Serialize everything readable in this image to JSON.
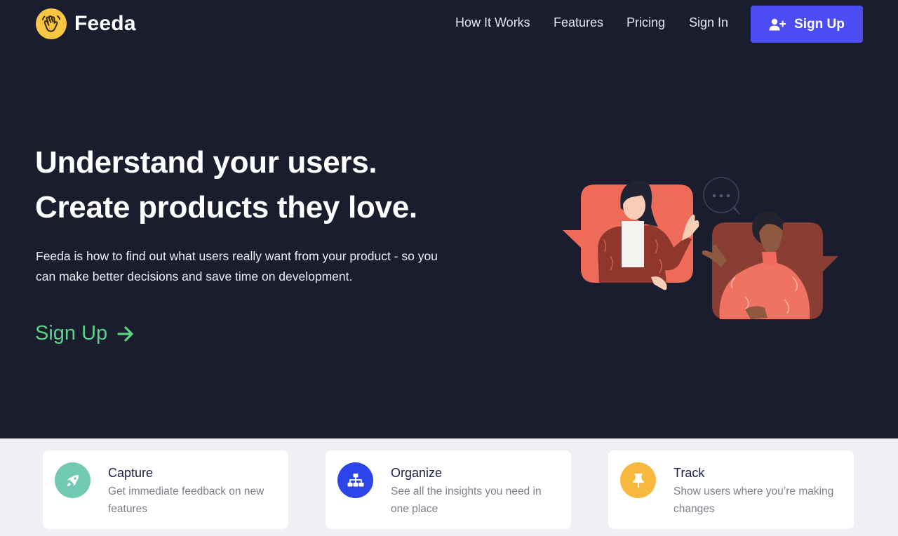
{
  "brand": {
    "name": "Feeda",
    "logo_icon": "waving-hand-icon"
  },
  "nav": {
    "links": [
      "How It Works",
      "Features",
      "Pricing",
      "Sign In"
    ],
    "signup_label": "Sign Up",
    "signup_icon": "user-plus-icon"
  },
  "hero": {
    "headline_line1": "Understand your users.",
    "headline_line2": "Create products they love.",
    "subtext": "Feeda is how to find out what users really want from your product - so you can make better decisions and save time on development.",
    "cta_label": "Sign Up",
    "cta_icon": "arrow-right-icon",
    "illustration": "two-people-chatting-illustration"
  },
  "features": [
    {
      "title": "Capture",
      "description": "Get immediate feedback on new features",
      "icon": "rocket-icon",
      "color": "#6fcab1"
    },
    {
      "title": "Organize",
      "description": "See all the insights you need in one place",
      "icon": "sitemap-icon",
      "color": "#2b45e8"
    },
    {
      "title": "Track",
      "description": "Show users where you’re making changes",
      "icon": "pushpin-icon",
      "color": "#f6b83f"
    }
  ],
  "colors": {
    "hero_bg": "#1a1d2e",
    "primary_button": "#4b4cf2",
    "cta_green": "#59d385",
    "logo_yellow": "#f7c744",
    "section_bg": "#eef0f6"
  }
}
